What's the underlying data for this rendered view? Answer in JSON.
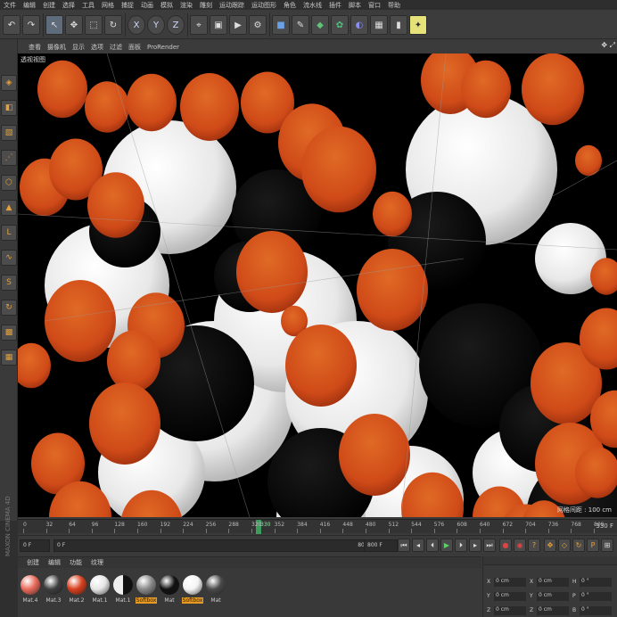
{
  "menu": [
    "文件",
    "编辑",
    "创建",
    "选择",
    "工具",
    "网格",
    "捕捉",
    "动画",
    "模拟",
    "渲染",
    "雕刻",
    "运动跟踪",
    "运动图形",
    "角色",
    "流水线",
    "插件",
    "脚本",
    "窗口",
    "帮助"
  ],
  "toolbar_icons": [
    "undo-icon",
    "redo-icon",
    "cursor-icon",
    "move-icon",
    "scale-icon",
    "rotate-icon",
    "x-axis-icon",
    "y-axis-icon",
    "z-axis-icon",
    "coordinate-system-icon",
    "render-region-icon",
    "render-view-icon",
    "render-settings-icon",
    "cube-icon",
    "pen-icon",
    "subdivision-icon",
    "array-icon",
    "deformer-icon",
    "floor-icon",
    "camera-icon",
    "light-icon"
  ],
  "axis_labels": {
    "x": "X",
    "y": "Y",
    "z": "Z"
  },
  "viewport_menu": [
    "查看",
    "摄像机",
    "显示",
    "选项",
    "过滤",
    "面板",
    "ProRender"
  ],
  "viewport_label": "透视视图",
  "grid_spacing": "网格间距 : 100 cm",
  "timeline": {
    "ticks": [
      "0",
      "32",
      "64",
      "96",
      "128",
      "160",
      "192",
      "224",
      "256",
      "288",
      "320",
      "352",
      "384",
      "416",
      "448",
      "480",
      "512",
      "544",
      "576",
      "608",
      "640",
      "672",
      "704",
      "736",
      "768",
      "800"
    ],
    "current_frame": "330",
    "end_label": "330 F"
  },
  "transport": {
    "start_frame": "0 F",
    "range_start": "0 F",
    "range_end": "800 F",
    "end_frame": "800 F"
  },
  "material_tabs": [
    "创建",
    "编辑",
    "功能",
    "纹理"
  ],
  "materials": [
    {
      "label": "Mat.4",
      "color": "#e86a5a",
      "highlight": false
    },
    {
      "label": "Mat.3",
      "color": "#3e3e3e",
      "highlight": false
    },
    {
      "label": "Mat.2",
      "color": "#d8401e",
      "highlight": false
    },
    {
      "label": "Mat.1",
      "color": "#e6e6e6",
      "highlight": false
    },
    {
      "label": "Mat.1",
      "color": "split",
      "highlight": false
    },
    {
      "label": "Softbox",
      "color": "#8a8a8a",
      "highlight": true
    },
    {
      "label": "Mat",
      "color": "#111111",
      "highlight": false
    },
    {
      "label": "Softbox",
      "color": "#f4f4f4",
      "highlight": true
    },
    {
      "label": "Mat",
      "color": "#4a4a4a",
      "highlight": false
    }
  ],
  "coords": [
    {
      "a": "X",
      "av": "0 cm",
      "b": "X",
      "bv": "0 cm",
      "c": "H",
      "cv": "0 °"
    },
    {
      "a": "Y",
      "av": "0 cm",
      "b": "Y",
      "bv": "0 cm",
      "c": "P",
      "cv": "0 °"
    },
    {
      "a": "Z",
      "av": "0 cm",
      "b": "Z",
      "bv": "0 cm",
      "c": "B",
      "cv": "0 °"
    }
  ],
  "brand_vertical": "MAXON CINEMA 4D",
  "colors": {
    "accent": "#e59a23",
    "playhead": "#3c9c5a",
    "orange_ball": "#d9531f"
  }
}
